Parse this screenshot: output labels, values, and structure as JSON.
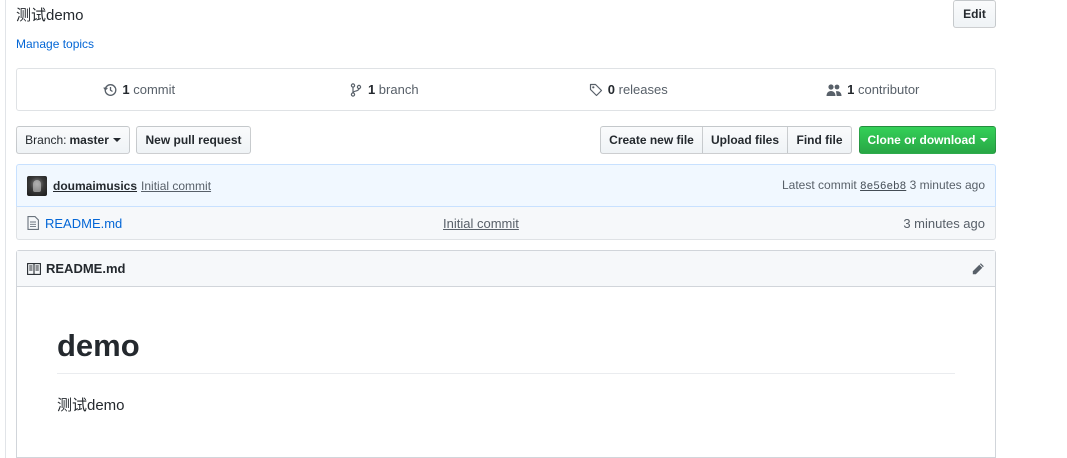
{
  "repo": {
    "description": "测试demo",
    "edit_label": "Edit",
    "manage_topics_label": "Manage topics"
  },
  "numbers": {
    "commits": {
      "count": "1",
      "label": "commit",
      "icon": "history-icon"
    },
    "branches": {
      "count": "1",
      "label": "branch",
      "icon": "branch-icon"
    },
    "releases": {
      "count": "0",
      "label": "releases",
      "icon": "tag-icon"
    },
    "contributors": {
      "count": "1",
      "label": "contributor",
      "icon": "people-icon"
    }
  },
  "file_nav": {
    "branch_prefix": "Branch:",
    "branch_name": "master",
    "new_pr_label": "New pull request",
    "create_file_label": "Create new file",
    "upload_files_label": "Upload files",
    "find_file_label": "Find file",
    "clone_label": "Clone or download"
  },
  "latest_commit": {
    "author": "doumaimusics",
    "message": "Initial commit",
    "prefix": "Latest commit",
    "sha": "8e56eb8",
    "age": "3 minutes ago"
  },
  "files": [
    {
      "name": "README.md",
      "message": "Initial commit",
      "age": "3 minutes ago",
      "icon": "file-icon"
    }
  ],
  "readme": {
    "title": "README.md",
    "heading": "demo",
    "paragraph": "测试demo"
  },
  "colors": {
    "link": "#0366d6",
    "primary_button": "#28a745",
    "commit_tease_bg": "#f1f8ff"
  }
}
